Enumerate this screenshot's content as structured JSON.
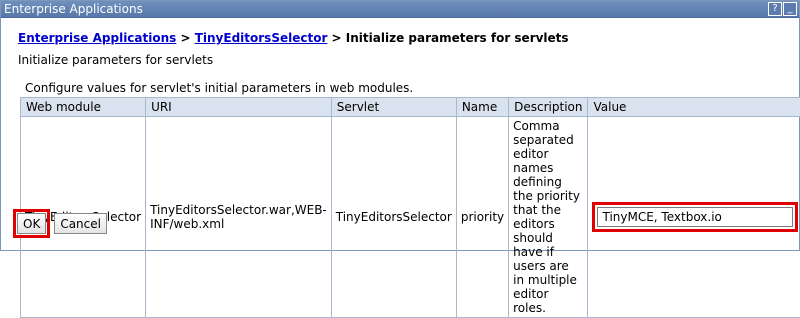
{
  "window": {
    "title": "Enterprise Applications",
    "help_icon": "?",
    "minimize_icon": "_"
  },
  "breadcrumb": {
    "link1": "Enterprise Applications",
    "sep1": " > ",
    "link2": "TinyEditorsSelector",
    "sep2": " > ",
    "current": "Initialize parameters for servlets"
  },
  "subtitle": "Initialize parameters for servlets",
  "instructions": "Configure values for servlet's initial parameters in web modules.",
  "table": {
    "headers": [
      "Web module",
      "URI",
      "Servlet",
      "Name",
      "Description",
      "Value"
    ],
    "rows": [
      {
        "web_module": "TinyEditorsSelector",
        "uri": "TinyEditorsSelector.war,WEB-INF/web.xml",
        "servlet": "TinyEditorsSelector",
        "name": "priority",
        "description": "Comma separated editor names defining the priority that the editors should have if users are in multiple editor roles.",
        "value": "TinyMCE, Textbox.io"
      }
    ]
  },
  "buttons": {
    "ok": "OK",
    "cancel": "Cancel"
  },
  "colors": {
    "highlight": "#e00000",
    "link": "#0000cc",
    "header_bg": "#d9e2ef",
    "titlebar": "#5f80b0"
  }
}
